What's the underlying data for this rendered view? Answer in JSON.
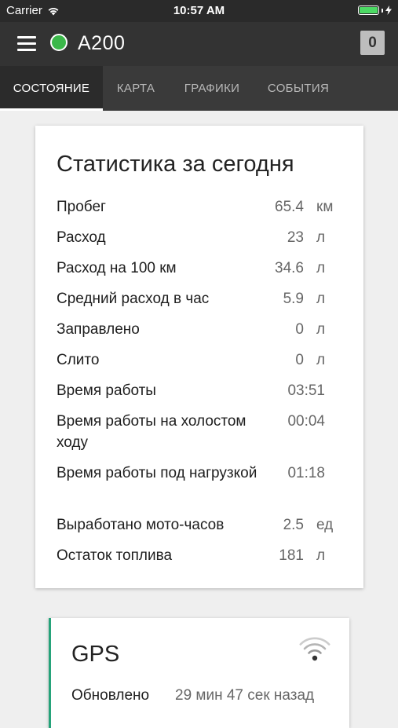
{
  "status_bar": {
    "carrier": "Carrier",
    "time": "10:57 AM"
  },
  "app_bar": {
    "vehicle_name": "A200",
    "status_color": "#3bb84a",
    "counter": "0"
  },
  "tabs": [
    {
      "label": "СОСТОЯНИЕ",
      "active": true
    },
    {
      "label": "КАРТА",
      "active": false
    },
    {
      "label": "ГРАФИКИ",
      "active": false
    },
    {
      "label": "СОБЫТИЯ",
      "active": false
    }
  ],
  "stats": {
    "title": "Статистика за сегодня",
    "rows": [
      {
        "label": "Пробег",
        "value": "65.4",
        "unit": "км"
      },
      {
        "label": "Расход",
        "value": "23",
        "unit": "л"
      },
      {
        "label": "Расход на 100 км",
        "value": "34.6",
        "unit": "л"
      },
      {
        "label": "Средний расход в час",
        "value": "5.9",
        "unit": "л"
      },
      {
        "label": "Заправлено",
        "value": "0",
        "unit": "л"
      },
      {
        "label": "Слито",
        "value": "0",
        "unit": "л"
      },
      {
        "label": "Время работы",
        "value": "03:51",
        "unit": ""
      },
      {
        "label": "Время работы на холостом ходу",
        "value": "00:04",
        "unit": ""
      },
      {
        "label": "Время работы под нагрузкой",
        "value": "01:18",
        "unit": ""
      },
      {
        "label": "Выработано мото-часов",
        "value": "2.5",
        "unit": "ед"
      },
      {
        "label": "Остаток топлива",
        "value": "181",
        "unit": "л"
      }
    ]
  },
  "gps": {
    "title": "GPS",
    "updated_label": "Обновлено",
    "updated_value": "29 мин 47 сек назад",
    "accent_color": "#26a37a"
  }
}
